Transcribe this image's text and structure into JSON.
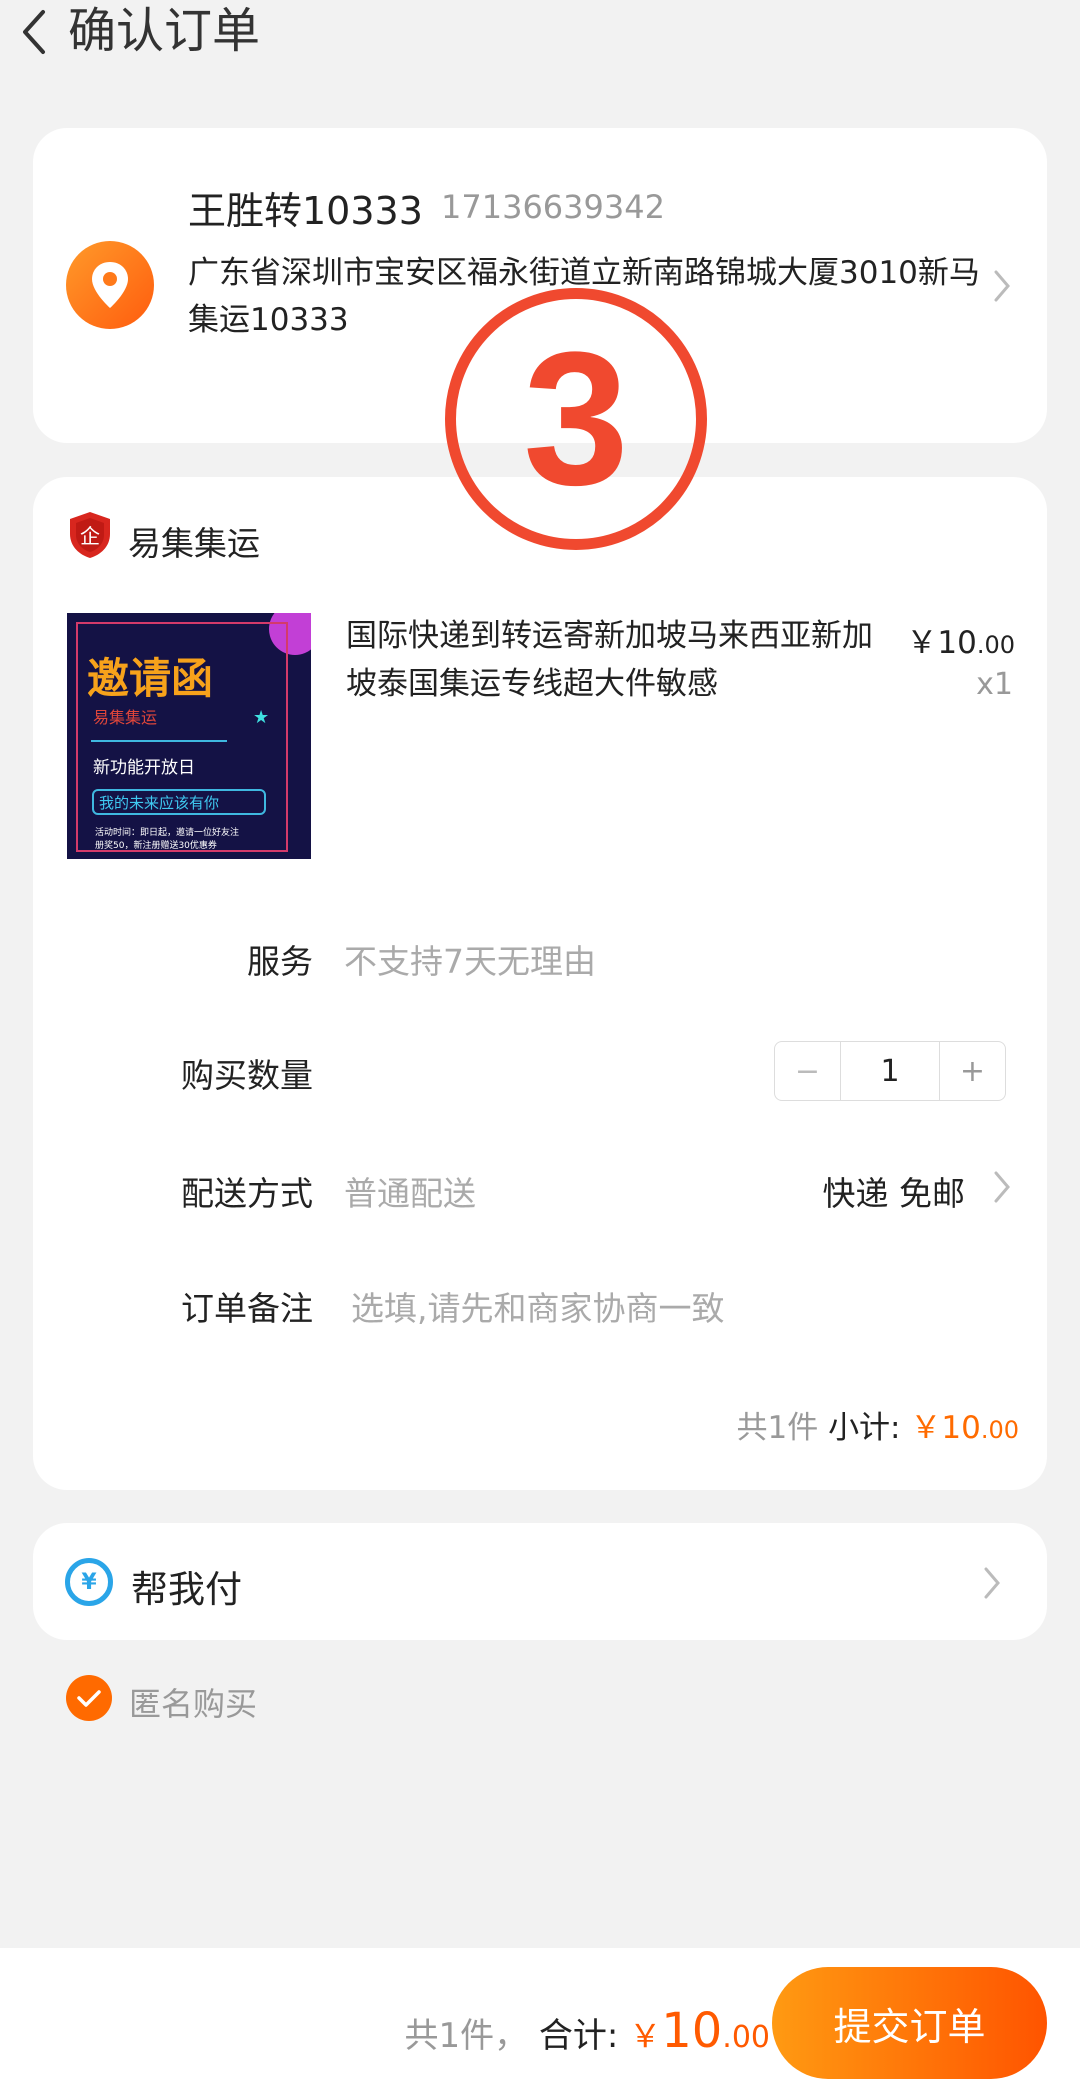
{
  "header": {
    "title": "确认订单"
  },
  "address": {
    "name": "王胜转10333",
    "phone": "17136639342",
    "line": "广东省深圳市宝安区福永街道立新南路锦城大厦3010新马集运10333"
  },
  "overlay": {
    "number": "3"
  },
  "store": {
    "name": "易集集运"
  },
  "product": {
    "title": "国际快递到转运寄新加坡马来西亚新加坡泰国集运专线超大件敏感",
    "price_main": "￥10",
    "price_decimal": ".00",
    "qty": "x1",
    "image": {
      "headline": "邀请函",
      "brand": "易集集运",
      "subtitle": "新功能开放日",
      "banner": "我的未来应该有你",
      "fine_print_1": "活动时间：即日起，邀请一位好友注",
      "fine_print_2": "册奖50，新注册赠送30优惠券"
    }
  },
  "rows": {
    "service_label": "服务",
    "service_value": "不支持7天无理由",
    "quantity_label": "购买数量",
    "quantity_value": "1",
    "minus": "−",
    "plus": "+",
    "shipping_label": "配送方式",
    "shipping_value": "普通配送",
    "shipping_right": "快递 免邮",
    "remark_label": "订单备注",
    "remark_placeholder": "选填,请先和商家协商一致"
  },
  "subtotal": {
    "count": "共1件",
    "label": "小计:",
    "amount_main": "￥10",
    "amount_decimal": ".00"
  },
  "pay_for_me": {
    "label": "帮我付",
    "icon_glyph": "¥"
  },
  "anonymous": {
    "label": "匿名购买",
    "checked": true
  },
  "footer": {
    "count": "共1件，",
    "label": "合计:",
    "yen": "￥",
    "amount_main": "10",
    "amount_decimal": ".00",
    "submit": "提交订单"
  },
  "colors": {
    "accent": "#ff6a00",
    "overlay_red": "#f0492f",
    "pay_blue": "#2aa5e8",
    "background": "#f2f2f2"
  }
}
